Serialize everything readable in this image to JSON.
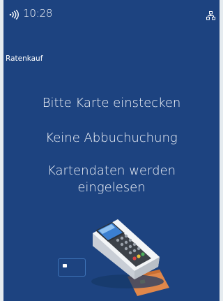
{
  "status_bar": {
    "time": "10:28",
    "left_icon": "contactless-icon",
    "right_icon": "network-icon"
  },
  "screen": {
    "title": "Ratenkauf",
    "messages": [
      "Bitte Karte einstecken",
      "Keine Abbuchuchung",
      "Kartendaten werden",
      "eingelesen"
    ]
  },
  "illustration": {
    "terminal": "payment-terminal-with-card-illustration",
    "small_card": "small-card-icon"
  },
  "colors": {
    "screen_background": "#1d4380",
    "outer_background": "#e5ebef",
    "text": "#ffffff"
  }
}
